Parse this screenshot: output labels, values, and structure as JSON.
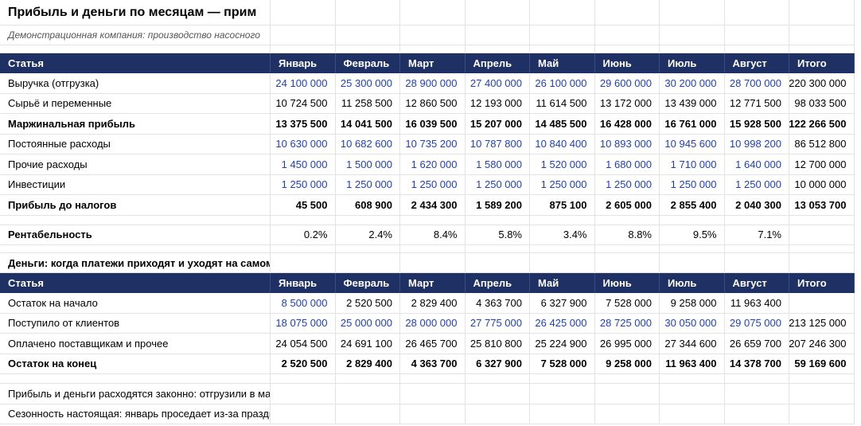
{
  "sheet": {
    "title": "Прибыль и деньги по месяцам — прим",
    "subtitle": "Демонстрационная компания: производство насосного",
    "columns": [
      "Статья",
      "Январь",
      "Февраль",
      "Март",
      "Апрель",
      "Май",
      "Июнь",
      "Июль",
      "Август",
      "Итого"
    ],
    "profit_rows": [
      {
        "label": "Выручка (отгрузка)",
        "values": [
          "24 100 000",
          "25 300 000",
          "28 900 000",
          "27 400 000",
          "26 100 000",
          "29 600 000",
          "30 200 000",
          "28 700 000"
        ],
        "total": "220 300 000",
        "blue": true,
        "bold": false
      },
      {
        "label": "Сырьё и переменные",
        "values": [
          "10 724 500",
          "11 258 500",
          "12 860 500",
          "12 193 000",
          "11 614 500",
          "13 172 000",
          "13 439 000",
          "12 771 500"
        ],
        "total": "98 033 500",
        "blue": false,
        "bold": false
      },
      {
        "label": "Маржинальная прибыль",
        "values": [
          "13 375 500",
          "14 041 500",
          "16 039 500",
          "15 207 000",
          "14 485 500",
          "16 428 000",
          "16 761 000",
          "15 928 500"
        ],
        "total": "122 266 500",
        "blue": false,
        "bold": true
      },
      {
        "label": "Постоянные расходы",
        "values": [
          "10 630 000",
          "10 682 600",
          "10 735 200",
          "10 787 800",
          "10 840 400",
          "10 893 000",
          "10 945 600",
          "10 998 200"
        ],
        "total": "86 512 800",
        "blue": true,
        "bold": false
      },
      {
        "label": "Прочие расходы",
        "values": [
          "1 450 000",
          "1 500 000",
          "1 620 000",
          "1 580 000",
          "1 520 000",
          "1 680 000",
          "1 710 000",
          "1 640 000"
        ],
        "total": "12 700 000",
        "blue": true,
        "bold": false
      },
      {
        "label": "Инвестиции",
        "values": [
          "1 250 000",
          "1 250 000",
          "1 250 000",
          "1 250 000",
          "1 250 000",
          "1 250 000",
          "1 250 000",
          "1 250 000"
        ],
        "total": "10 000 000",
        "blue": true,
        "bold": false
      },
      {
        "label": "Прибыль до налогов",
        "values": [
          "45 500",
          "608 900",
          "2 434 300",
          "1 589 200",
          "875 100",
          "2 605 000",
          "2 855 400",
          "2 040 300"
        ],
        "total": "13 053 700",
        "blue": false,
        "bold": true
      }
    ],
    "profitability": {
      "label": "Рентабельность",
      "values": [
        "0.2%",
        "2.4%",
        "8.4%",
        "5.8%",
        "3.4%",
        "8.8%",
        "9.5%",
        "7.1%"
      ],
      "total": ""
    },
    "cash_section_title": "Деньги: когда платежи приходят и уходят на самом д",
    "cash_rows": [
      {
        "label": "Остаток на начало",
        "values": [
          "8 500 000",
          "2 520 500",
          "2 829 400",
          "4 363 700",
          "6 327 900",
          "7 528 000",
          "9 258 000",
          "11 963 400"
        ],
        "total": "",
        "blue_first": true,
        "blue": false,
        "bold": false
      },
      {
        "label": "Поступило от клиентов",
        "values": [
          "18 075 000",
          "25 000 000",
          "28 000 000",
          "27 775 000",
          "26 425 000",
          "28 725 000",
          "30 050 000",
          "29 075 000"
        ],
        "total": "213 125 000",
        "blue_first": false,
        "blue": true,
        "bold": false
      },
      {
        "label": "Оплачено поставщикам и прочее",
        "values": [
          "24 054 500",
          "24 691 100",
          "26 465 700",
          "25 810 800",
          "25 224 900",
          "26 995 000",
          "27 344 600",
          "26 659 700"
        ],
        "total": "207 246 300",
        "blue_first": false,
        "blue": false,
        "bold": false
      },
      {
        "label": "Остаток на конец",
        "values": [
          "2 520 500",
          "2 829 400",
          "4 363 700",
          "6 327 900",
          "7 528 000",
          "9 258 000",
          "11 963 400",
          "14 378 700"
        ],
        "total": "59 169 600",
        "blue_first": false,
        "blue": false,
        "bold": true
      }
    ],
    "notes": [
      "Прибыль и деньги расходятся законно: отгрузили в март",
      "Сезонность настоящая: январь проседает из-за праздни"
    ]
  }
}
